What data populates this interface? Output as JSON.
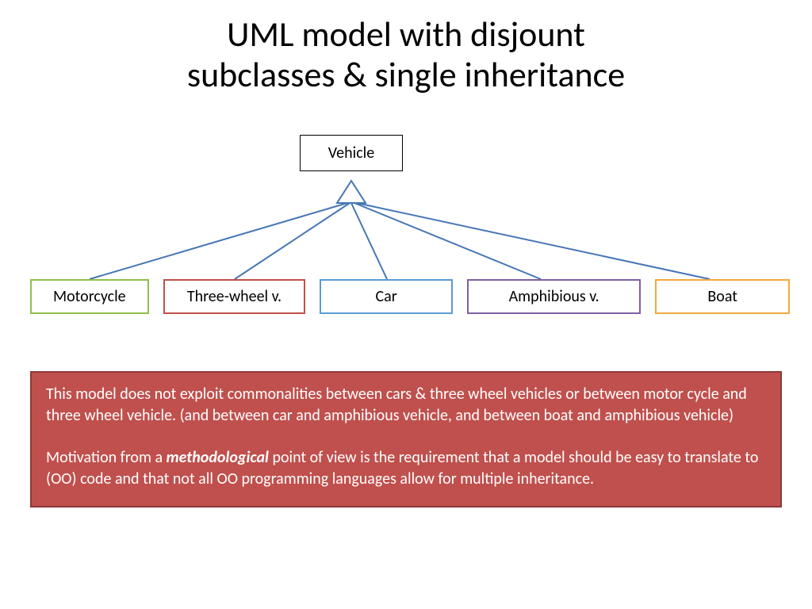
{
  "title_line1": "UML model  with disjount",
  "title_line2": "subclasses & single inheritance",
  "diagram": {
    "parent": "Vehicle",
    "children": [
      {
        "label": "Motorcycle",
        "color": "#8fbf4d"
      },
      {
        "label": "Three-wheel v.",
        "color": "#c0504d"
      },
      {
        "label": "Car",
        "color": "#5b9bd5"
      },
      {
        "label": "Amphibious v.",
        "color": "#7e5fa4"
      },
      {
        "label": "Boat",
        "color": "#f2a93c"
      }
    ],
    "connector_color": "#4676b6"
  },
  "note": {
    "para1": "This model does not exploit commonalities between cars & three wheel vehicles or between motor cycle and three wheel vehicle. (and between car and amphibious vehicle, and between boat and amphibious vehicle)",
    "para2_pre": "Motivation from a ",
    "para2_emph": "methodological",
    "para2_post": " point of view is the requirement that a model should be easy to translate to (OO) code and that not all OO programming languages allow for multiple inheritance."
  }
}
